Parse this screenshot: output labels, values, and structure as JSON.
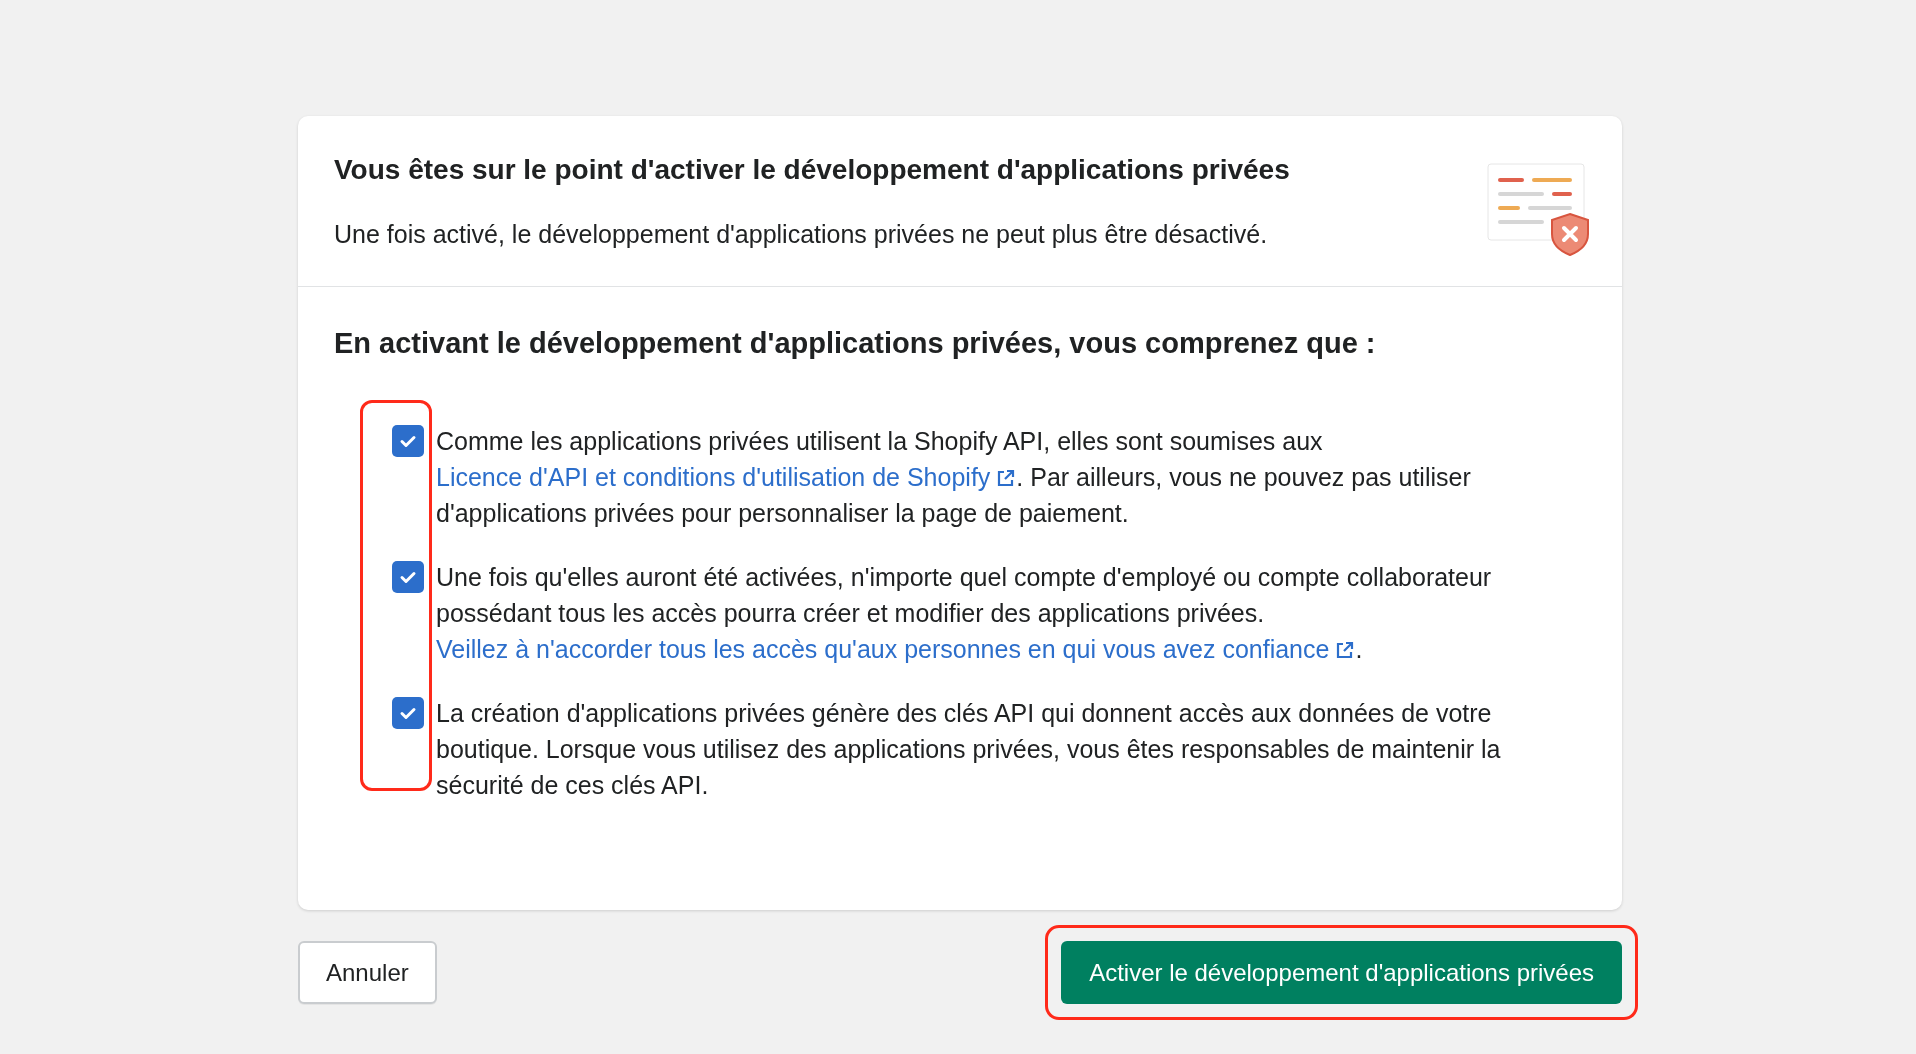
{
  "dialog": {
    "title": "Vous êtes sur le point d'activer le développement d'applications privées",
    "description": "Une fois activé, le développement d'applications privées ne peut plus être désactivé.",
    "heading": "En activant le développement d'applications privées, vous comprenez que :",
    "items": [
      {
        "checked": true,
        "parts": [
          {
            "kind": "text",
            "text": "Comme les applications privées utilisent la Shopify API, elles sont soumises aux "
          },
          {
            "kind": "link",
            "text": "Licence d'API et conditions d'utilisation de Shopify"
          },
          {
            "kind": "text",
            "text": ". Par ailleurs, vous ne pouvez pas utiliser d'applications privées pour personnaliser la page de paiement."
          }
        ]
      },
      {
        "checked": true,
        "parts": [
          {
            "kind": "text",
            "text": "Une fois qu'elles auront été activées, n'importe quel compte d'employé ou compte collaborateur possédant tous les accès pourra créer et modifier des applications privées. "
          },
          {
            "kind": "link",
            "text": "Veillez à n'accorder tous les accès qu'aux personnes en qui vous avez confiance"
          },
          {
            "kind": "text",
            "text": "."
          }
        ]
      },
      {
        "checked": true,
        "parts": [
          {
            "kind": "text",
            "text": "La création d'applications privées génère des clés API qui donnent accès aux données de votre boutique. Lorsque vous utilisez des applications privées, vous êtes responsables de maintenir la sécurité de ces clés API."
          }
        ]
      }
    ],
    "checkboxes_highlighted": true
  },
  "buttons": [
    {
      "kind": "secondary",
      "label": "Annuler",
      "highlighted": false
    },
    {
      "kind": "primary",
      "label": "Activer le développement d'applications privées",
      "highlighted": true
    }
  ]
}
